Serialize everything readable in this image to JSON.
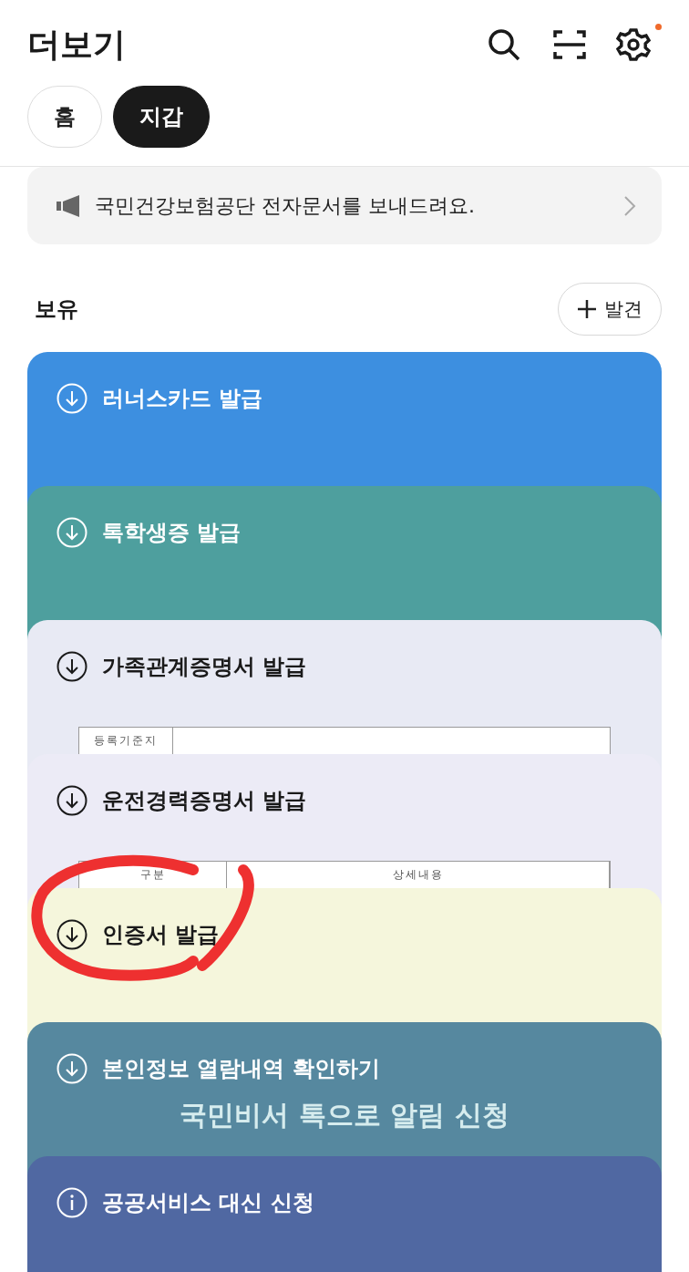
{
  "header": {
    "title": "더보기",
    "settings_badge": true
  },
  "tabs": [
    {
      "label": "홈",
      "selected": false
    },
    {
      "label": "지갑",
      "selected": true
    }
  ],
  "notice": {
    "text": "국민건강보험공단 전자문서를 보내드려요."
  },
  "section": {
    "title": "보유",
    "add_button": "발견"
  },
  "cards": [
    {
      "title": "러너스카드 발급",
      "kind": "download",
      "color": "#3d8fe0"
    },
    {
      "title": "톡학생증 발급",
      "kind": "download",
      "color": "#4e9f9e"
    },
    {
      "title": "가족관계증명서 발급",
      "kind": "download",
      "color": "#e8eaf4",
      "preview": {
        "kind": "form",
        "cells": [
          "등록기준지"
        ]
      }
    },
    {
      "title": "운전경력증명서 발급",
      "kind": "download",
      "color": "#ecebf6",
      "preview": {
        "kind": "table",
        "cells": [
          "구분",
          "상세내용"
        ]
      }
    },
    {
      "title": "인증서 발급",
      "kind": "download",
      "color": "#f5f6dc"
    },
    {
      "title": "본인정보 열람내역 확인하기",
      "kind": "download",
      "color": "#56889f",
      "preview": {
        "kind": "banner",
        "text": "국민비서 톡으로 알림 신청"
      }
    },
    {
      "title": "공공서비스 대신 신청",
      "kind": "info",
      "color": "#5068a2"
    }
  ],
  "annotation": {
    "kind": "circle"
  }
}
